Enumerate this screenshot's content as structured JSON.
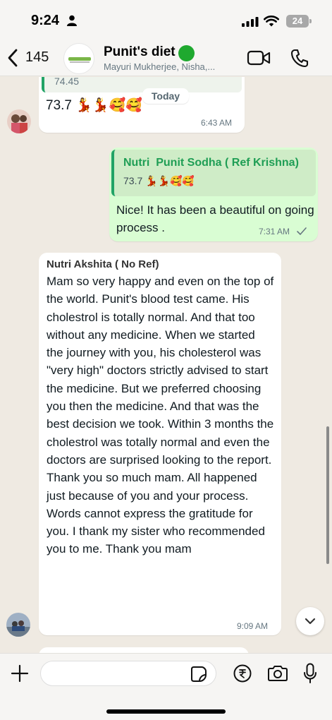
{
  "status_bar": {
    "time": "9:24",
    "battery": "24"
  },
  "header": {
    "back_count": "145",
    "group_name": "Punit's diet",
    "members": "Mayuri Mukherjee, Nisha,..."
  },
  "chat": {
    "date_divider": "Today",
    "messages": [
      {
        "direction": "in",
        "quoted_text": "74.45",
        "text": "73.7 💃💃🥰🥰",
        "time": "6:43 AM"
      },
      {
        "direction": "out",
        "quoted_sender": "Nutri  Punit Sodha ( Ref Krishna)",
        "quoted_text": "73.7 💃💃🥰🥰",
        "text": "Nice! It has been a beautiful on going process .",
        "time": "7:31 AM",
        "status": "delivered"
      },
      {
        "direction": "in",
        "sender": "Nutri Akshita ( No Ref)",
        "text": "Mam so very happy and even on the top of the world. Punit's blood test came. His cholestrol is totally normal. And that too without any medicine. When we started the journey with you, his cholesterol was \"very high\" doctors strictly advised to start the medicine. But we preferred choosing you then the medicine. And that was the best decision we took. Within 3 months the cholestrol was totally normal and even the doctors are surprised looking to the report. Thank you so much mam. All happened just because of you and your process. Words cannot express the gratitude for you. I thank my sister who recommended you to me. Thank you mam",
        "time": "9:09 AM"
      }
    ]
  },
  "input": {
    "value": "",
    "placeholder": ""
  },
  "colors": {
    "chat_bg": "#efeae2",
    "outgoing_bubble": "#d9fdd3",
    "incoming_bubble": "#ffffff",
    "quote_accent": "#21a366",
    "online_dot": "#1fa92f"
  },
  "icons": {
    "back": "chevron-left-icon",
    "video": "video-camera-icon",
    "call": "phone-icon",
    "scroll": "chevron-down-icon",
    "plus": "plus-icon",
    "sticker": "sticker-icon",
    "payment": "rupee-icon",
    "camera": "camera-icon",
    "mic": "microphone-icon"
  }
}
